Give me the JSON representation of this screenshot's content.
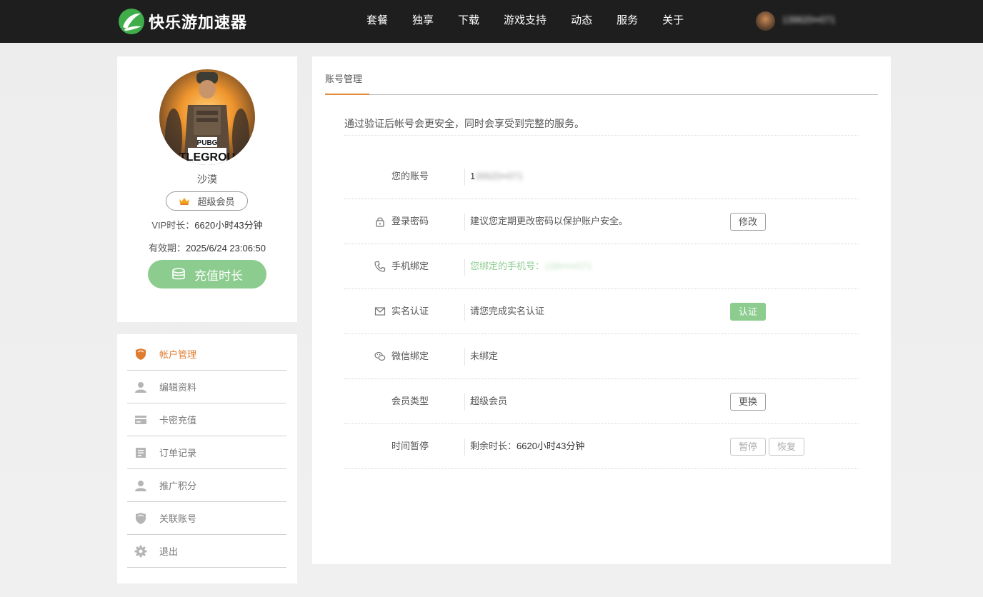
{
  "header": {
    "brand": "快乐游加速器",
    "nav": [
      "套餐",
      "独享",
      "下载",
      "游戏支持",
      "动态",
      "服务",
      "关于"
    ],
    "username_masked": "139620••071",
    "avatar_icon": "user-avatar-icon"
  },
  "profile": {
    "avatar_badge": "PUBG",
    "avatar_caption": "TLEGROU",
    "nickname": "沙漠",
    "vip_badge": "超级会员",
    "vip_time_label": "VIP时长：",
    "vip_time_value": "6620小时43分钟",
    "expiry_label": "有效期：",
    "expiry_value": "2025/6/24 23:06:50",
    "recharge_label": "充值时长"
  },
  "menu": [
    {
      "label": "帐户管理",
      "icon": "shield-icon",
      "active": true
    },
    {
      "label": "编辑资料",
      "icon": "user-icon",
      "active": false
    },
    {
      "label": "卡密充值",
      "icon": "card-icon",
      "active": false
    },
    {
      "label": "订单记录",
      "icon": "list-icon",
      "active": false
    },
    {
      "label": "推广积分",
      "icon": "user-icon",
      "active": false
    },
    {
      "label": "关联账号",
      "icon": "shield-icon",
      "active": false
    },
    {
      "label": "退出",
      "icon": "gear-icon",
      "active": false
    }
  ],
  "main": {
    "tab": "账号管理",
    "notice": "通过验证后帐号会更安全，同时会享受到完整的服务。",
    "rows": [
      {
        "icon": "",
        "label": "您的账号",
        "value_prefix": "1",
        "value_masked": "39620••071",
        "button": ""
      },
      {
        "icon": "lock-icon",
        "label": "登录密码",
        "value": "建议您定期更改密码以保护账户安全。",
        "button": "修改"
      },
      {
        "icon": "phone-icon",
        "label": "手机绑定",
        "value": "您绑定的手机号：",
        "value_masked": "139•••••071",
        "button": ""
      },
      {
        "icon": "mail-icon",
        "label": "实名认证",
        "value": "请您完成实名认证",
        "button": "认证"
      },
      {
        "icon": "wechat-icon",
        "label": "微信绑定",
        "value": "未绑定",
        "button": ""
      },
      {
        "icon": "",
        "label": "会员类型",
        "value": "超级会员",
        "button": "更换"
      },
      {
        "icon": "",
        "label": "时间暂停",
        "value": "剩余时长：",
        "value_dark": "6620小时43分钟",
        "button": "暂停",
        "button2": "恢复"
      }
    ]
  },
  "colors": {
    "topbar": "#1e1e1e",
    "green": "#8ccc8f",
    "orange": "#e07c2f",
    "brand_green": "#3fae4a"
  }
}
